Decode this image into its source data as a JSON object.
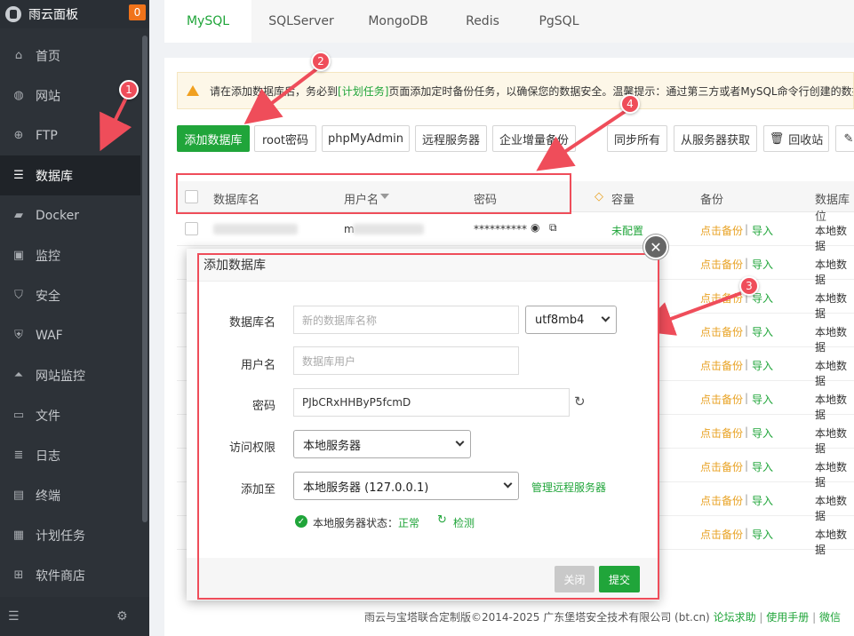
{
  "sidebar": {
    "title": "雨云面板",
    "badge": "0",
    "items": [
      {
        "label": "首页",
        "icon": "home-icon"
      },
      {
        "label": "网站",
        "icon": "globe-icon"
      },
      {
        "label": "FTP",
        "icon": "ftp-icon"
      },
      {
        "label": "数据库",
        "icon": "database-icon"
      },
      {
        "label": "Docker",
        "icon": "docker-icon"
      },
      {
        "label": "监控",
        "icon": "monitor-icon"
      },
      {
        "label": "安全",
        "icon": "shield-icon"
      },
      {
        "label": "WAF",
        "icon": "waf-icon"
      },
      {
        "label": "网站监控",
        "icon": "chart-icon"
      },
      {
        "label": "文件",
        "icon": "folder-icon"
      },
      {
        "label": "日志",
        "icon": "log-icon"
      },
      {
        "label": "终端",
        "icon": "terminal-icon"
      },
      {
        "label": "计划任务",
        "icon": "calendar-icon"
      },
      {
        "label": "软件商店",
        "icon": "store-icon"
      }
    ],
    "active_index": 3
  },
  "tabs": [
    "MySQL",
    "SQLServer",
    "MongoDB",
    "Redis",
    "PgSQL"
  ],
  "warning": {
    "prefix": "请在添加数据库后，务必到",
    "link": "[计划任务]",
    "suffix": "页面添加定时备份任务，以确保您的数据安全。温馨提示：通过第三方或者MySQL命令行创建的数据"
  },
  "toolbar": {
    "add_db": "添加数据库",
    "root_password": "root密码",
    "phpmyadmin": "phpMyAdmin",
    "remote_server": "远程服务器",
    "incremental_backup": "企业增量备份",
    "sync_all": "同步所有",
    "fetch_from_server": "从服务器获取",
    "recycle_bin": "回收站"
  },
  "table": {
    "headers": {
      "name": "数据库名",
      "user": "用户名",
      "password": "密码",
      "capacity": "容量",
      "backup": "备份",
      "location": "数据库位"
    },
    "first_row": {
      "user_prefix": "m",
      "password": "**********",
      "capacity": "未配置"
    },
    "backup_link": "点击备份",
    "separator": "|",
    "import_link": "导入",
    "location": "本地数据"
  },
  "modal": {
    "title": "添加数据库",
    "fields": {
      "db_name_label": "数据库名",
      "db_name_placeholder": "新的数据库名称",
      "charset": "utf8mb4",
      "user_label": "用户名",
      "user_placeholder": "数据库用户",
      "password_label": "密码",
      "password_value": "PJbCRxHHByP5fcmD",
      "access_label": "访问权限",
      "access_value": "本地服务器",
      "add_to_label": "添加至",
      "add_to_value": "本地服务器 (127.0.0.1)",
      "manage_remote": "管理远程服务器",
      "status_label": "本地服务器状态：",
      "status_value": "正常",
      "detect": "检测"
    },
    "close_btn": "关闭",
    "submit_btn": "提交"
  },
  "annotations": [
    "1",
    "2",
    "3",
    "4"
  ],
  "footer": {
    "text": "雨云与宝塔联合定制版©2014-2025 广东堡塔安全技术有限公司 (bt.cn)",
    "forum": "论坛求助",
    "manual": "使用手册",
    "wechat": "微信"
  },
  "colors": {
    "accent": "#20a53a",
    "annotation": "#ef4d5a",
    "sidebar": "#2d3238",
    "warning_link": "#e8a223"
  }
}
